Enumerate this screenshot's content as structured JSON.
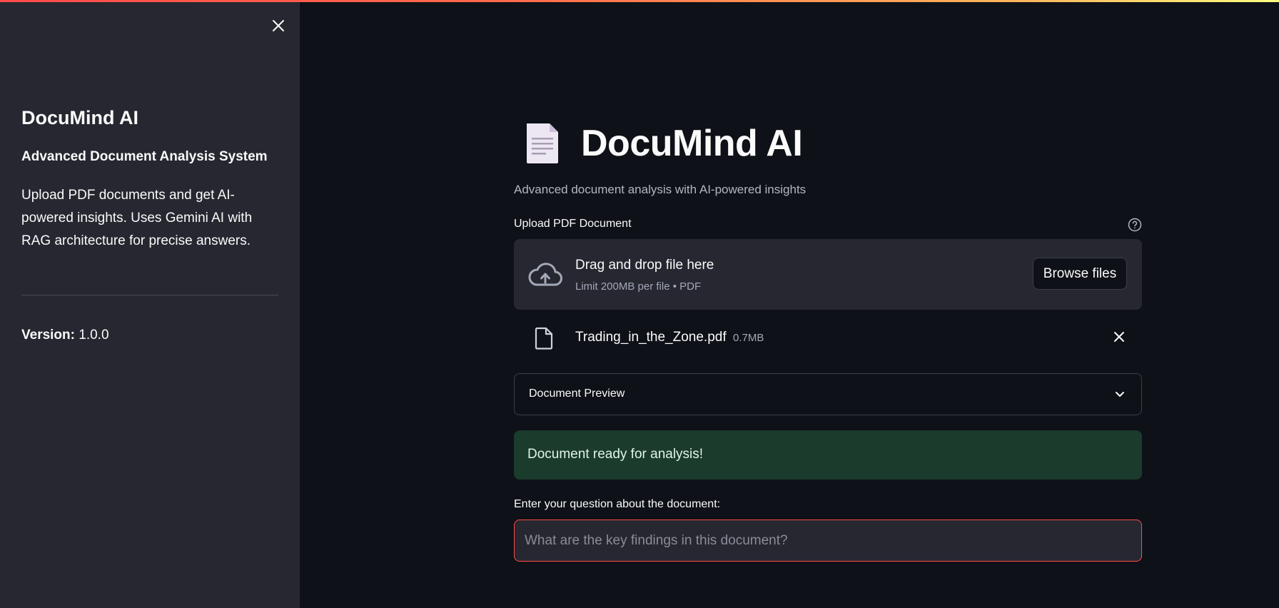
{
  "sidebar": {
    "close_icon": "close-icon",
    "title": "DocuMind AI",
    "subtitle": "Advanced Document Analysis System",
    "description": "Upload PDF documents and get AI-powered insights. Uses Gemini AI with RAG architecture for precise answers.",
    "version_label": "Version:",
    "version_value": "1.0.0"
  },
  "header": {
    "icon": "document-icon",
    "title": "DocuMind AI",
    "subtitle": "Advanced document analysis with AI-powered insights"
  },
  "uploader": {
    "label": "Upload PDF Document",
    "help_icon": "help-icon",
    "drop_title": "Drag and drop file here",
    "drop_limit": "Limit 200MB per file • PDF",
    "browse_label": "Browse files",
    "file": {
      "name": "Trading_in_the_Zone.pdf",
      "size": "0.7MB"
    }
  },
  "preview": {
    "label": "Document Preview"
  },
  "status": {
    "message": "Document ready for analysis!",
    "color": "#1b3b2c"
  },
  "question": {
    "label": "Enter your question about the document:",
    "placeholder": "What are the key findings in this document?",
    "value": ""
  },
  "colors": {
    "accent": "#ff4b4b",
    "background": "#0e1117",
    "sidebar": "#262730"
  }
}
